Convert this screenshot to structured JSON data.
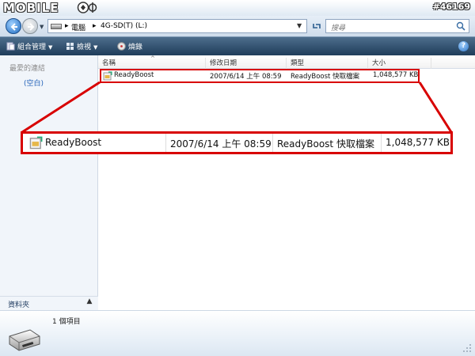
{
  "watermark": {
    "logo": "MOBILE",
    "thread_id": "#46169"
  },
  "address": {
    "separator": "▸",
    "crumbs": [
      "電腦",
      "4G-SD(T) (L:)"
    ],
    "search_placeholder": "搜尋"
  },
  "toolbar": {
    "organize": "組合管理",
    "views": "檢視",
    "burn": "燒錄",
    "help": "?"
  },
  "left_pane": {
    "favorites_title": "最愛的連結",
    "favorites_empty": "(空白)",
    "folders_label": "資料夾"
  },
  "columns": [
    "名稱",
    "修改日期",
    "類型",
    "大小"
  ],
  "file": {
    "name": "ReadyBoost",
    "modified": "2007/6/14 上午 08:59",
    "type": "ReadyBoost 快取檔案",
    "size": "1,048,577 KB"
  },
  "details": {
    "item_count": "1 個項目"
  },
  "colors": {
    "highlight": "#d80000",
    "toolbar": "#2f4f6f",
    "link": "#1f5fb7"
  }
}
